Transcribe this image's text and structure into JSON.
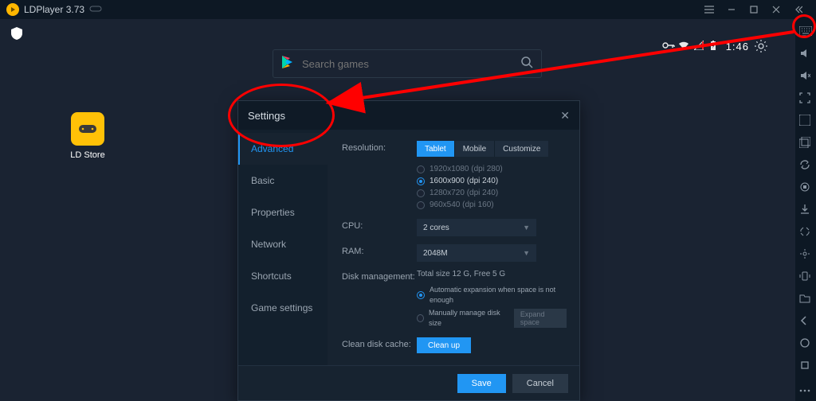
{
  "titlebar": {
    "title": "LDPlayer 3.73"
  },
  "statusbar": {
    "clock": "1:46"
  },
  "desktop": {
    "ld_store_label": "LD Store"
  },
  "search": {
    "placeholder": "Search games"
  },
  "settings": {
    "title": "Settings",
    "sidebar": [
      {
        "label": "Advanced",
        "active": true
      },
      {
        "label": "Basic",
        "active": false
      },
      {
        "label": "Properties",
        "active": false
      },
      {
        "label": "Network",
        "active": false
      },
      {
        "label": "Shortcuts",
        "active": false
      },
      {
        "label": "Game settings",
        "active": false
      }
    ],
    "resolution": {
      "label": "Resolution:",
      "tabs": [
        {
          "label": "Tablet",
          "active": true
        },
        {
          "label": "Mobile",
          "active": false
        },
        {
          "label": "Customize",
          "active": false
        }
      ],
      "options": [
        {
          "label": "1920x1080  (dpi 280)",
          "selected": false
        },
        {
          "label": "1600x900  (dpi 240)",
          "selected": true
        },
        {
          "label": "1280x720  (dpi 240)",
          "selected": false
        },
        {
          "label": "960x540  (dpi 160)",
          "selected": false
        }
      ]
    },
    "cpu": {
      "label": "CPU:",
      "value": "2 cores"
    },
    "ram": {
      "label": "RAM:",
      "value": "2048M"
    },
    "disk": {
      "label": "Disk management:",
      "info": "Total size 12 G,   Free 5 G",
      "auto_option": "Automatic expansion when space is not enough",
      "manual_option": "Manually manage disk size",
      "expand_btn": "Expand space"
    },
    "clean": {
      "label": "Clean disk cache:",
      "button": "Clean up"
    },
    "footer": {
      "save": "Save",
      "cancel": "Cancel"
    }
  }
}
